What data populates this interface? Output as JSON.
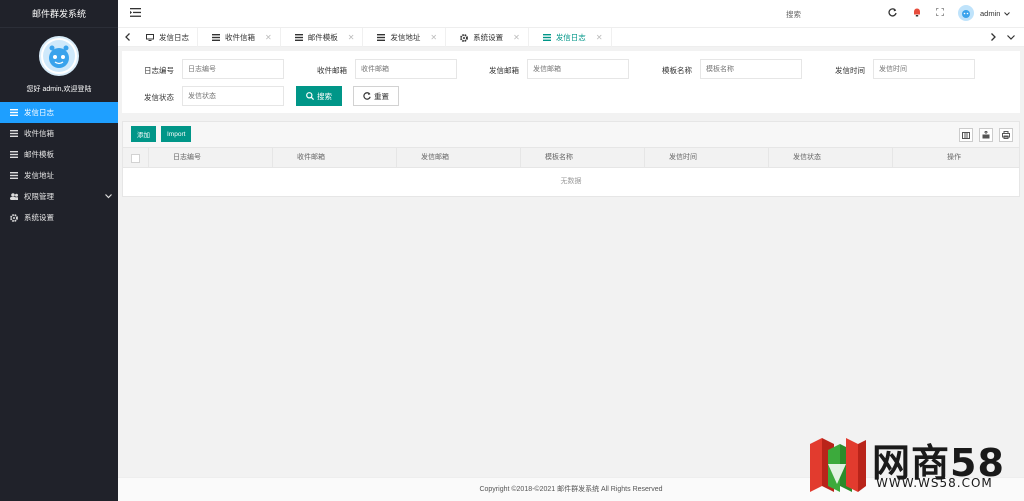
{
  "app": {
    "title": "邮件群发系统"
  },
  "sidebar": {
    "welcome": "您好 admin,欢迎登陆",
    "items": [
      {
        "label": "发信日志",
        "icon": "list-icon",
        "active": true
      },
      {
        "label": "收件信箱",
        "icon": "list-icon"
      },
      {
        "label": "邮件模板",
        "icon": "list-icon"
      },
      {
        "label": "发信地址",
        "icon": "list-icon"
      },
      {
        "label": "权限管理",
        "icon": "users-icon",
        "expandable": true
      },
      {
        "label": "系统设置",
        "icon": "gear-icon"
      }
    ]
  },
  "header": {
    "search_label": "搜索",
    "username": "admin"
  },
  "tabs": [
    {
      "label": "发信日志",
      "icon": "monitor-icon",
      "closable": false
    },
    {
      "label": "收件信箱",
      "icon": "list-icon",
      "closable": true
    },
    {
      "label": "邮件模板",
      "icon": "list-icon",
      "closable": true
    },
    {
      "label": "发信地址",
      "icon": "list-icon",
      "closable": true
    },
    {
      "label": "系统设置",
      "icon": "gear-icon",
      "closable": true
    },
    {
      "label": "发信日志",
      "icon": "list-icon",
      "closable": true,
      "active": true
    }
  ],
  "filters": {
    "log_id": {
      "label": "日志编号",
      "placeholder": "日志编号"
    },
    "recv_mail": {
      "label": "收件邮箱",
      "placeholder": "收件邮箱"
    },
    "send_mail": {
      "label": "发信邮箱",
      "placeholder": "发信邮箱"
    },
    "template": {
      "label": "模板名称",
      "placeholder": "模板名称"
    },
    "send_time": {
      "label": "发信时间",
      "placeholder": "发信时间"
    },
    "status": {
      "label": "发信状态",
      "placeholder": "发信状态"
    },
    "search_btn": "搜索",
    "reset_btn": "重置"
  },
  "table": {
    "add_btn": "添加",
    "import_btn": "Import",
    "columns": [
      "日志编号",
      "收件邮箱",
      "发信邮箱",
      "模板名称",
      "发信时间",
      "发信状态",
      "操作"
    ],
    "empty": "无数据"
  },
  "footer": {
    "copyright": "Copyright ©2018-©2021 邮件群发系统 All Rights Reserved"
  },
  "watermark": {
    "text": "网商58",
    "url": "WWW.WS58.COM"
  },
  "colors": {
    "sidebar_bg": "#20222a",
    "active": "#1e9fff",
    "primary": "#009688"
  }
}
